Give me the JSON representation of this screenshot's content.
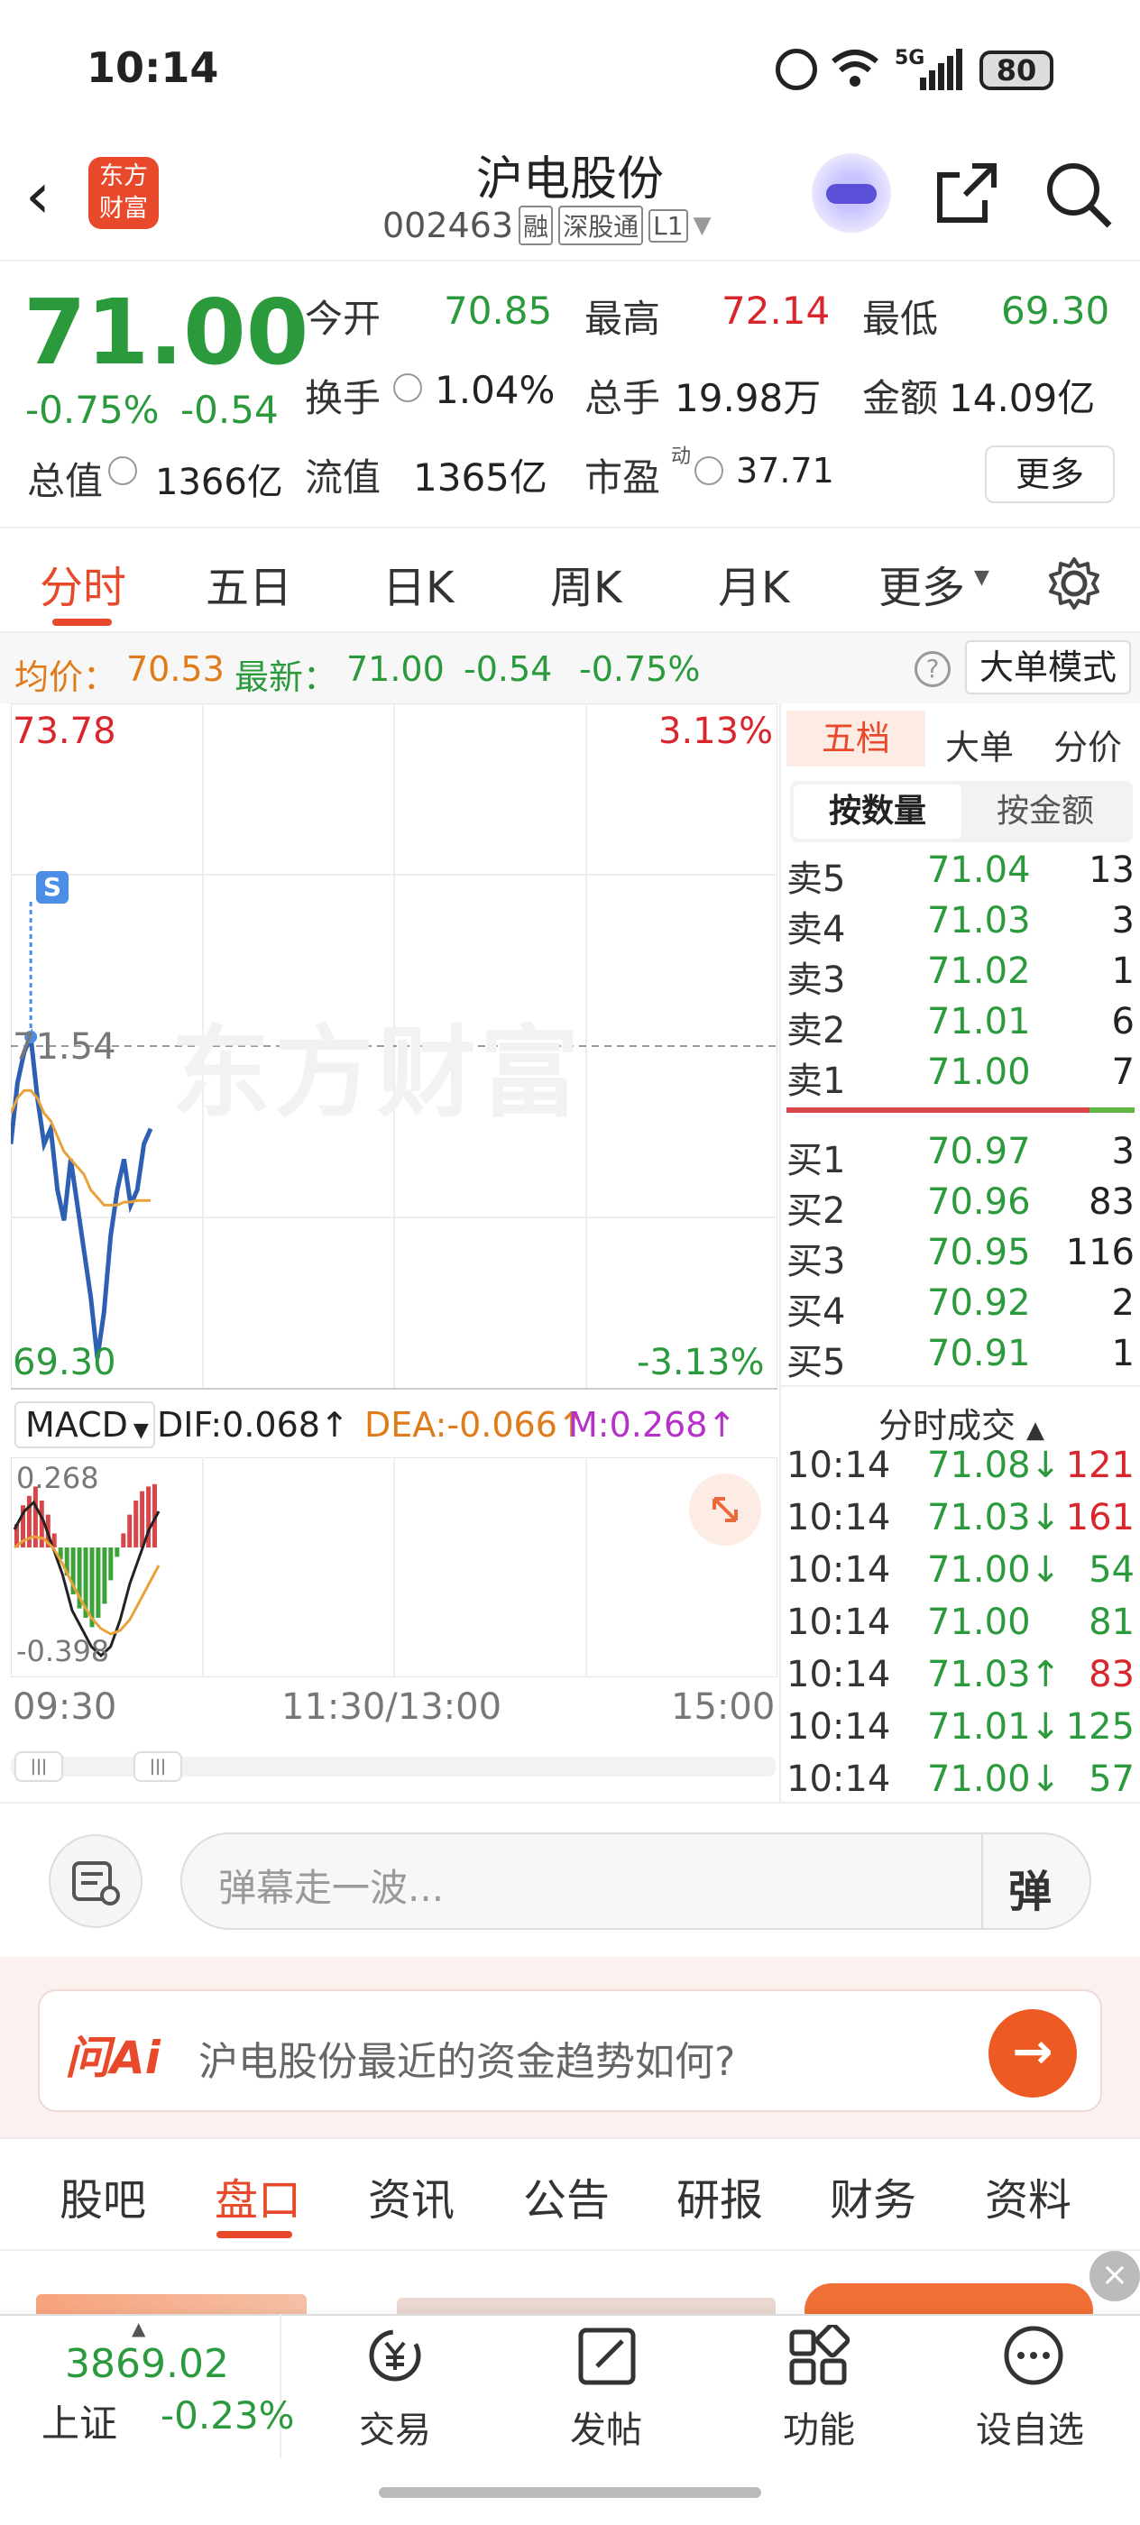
{
  "status": {
    "time": "10:14",
    "battery": "80",
    "network": "5G"
  },
  "header": {
    "logo_line1": "东方",
    "logo_line2": "财富",
    "title": "沪电股份",
    "code": "002463",
    "tags": [
      "融",
      "深股通",
      "L1"
    ]
  },
  "quote": {
    "price": "71.00",
    "pct": "-0.75%",
    "chg": "-0.54",
    "open_label": "今开",
    "open": "70.85",
    "high_label": "最高",
    "high": "72.14",
    "low_label": "最低",
    "low": "69.30",
    "turnover_label": "换手",
    "turnover": "1.04%",
    "volume_label": "总手",
    "volume": "19.98万",
    "amount_label": "金额",
    "amount": "14.09亿",
    "mcap_label": "总值",
    "mcap": "1366亿",
    "float_label": "流值",
    "float": "1365亿",
    "pe_label": "市盈",
    "pe_sup": "动",
    "pe": "37.71",
    "more": "更多"
  },
  "tabs": [
    "分时",
    "五日",
    "日K",
    "周K",
    "月K",
    "更多"
  ],
  "info_line": {
    "avg_label": "均价：",
    "avg": "70.53",
    "latest_label": "最新：",
    "latest": "71.00",
    "chg": "-0.54",
    "pct": "-0.75%",
    "mode": "大单模式"
  },
  "chart": {
    "y_top": "73.78",
    "y_mid": "71.54",
    "y_bottom": "69.30",
    "pct_top": "3.13%",
    "pct_bottom": "-3.13%",
    "marker": "S",
    "watermark": "东方财富",
    "macd_label": "MACD",
    "dif": "DIF:0.068",
    "dea": "DEA:-0.066",
    "m": "M:0.268",
    "macd_top": "0.268",
    "macd_bottom": "-0.398",
    "time_start": "09:30",
    "time_mid": "11:30/13:00",
    "time_end": "15:00"
  },
  "chart_data": {
    "type": "line",
    "title": "",
    "series": [
      {
        "name": "",
        "values": [
          70.9,
          71.3,
          71.5,
          71.6,
          71.2,
          70.9,
          71.0,
          70.6,
          70.4,
          70.8,
          70.5,
          70.2,
          69.9,
          69.5,
          69.8,
          70.3,
          70.6,
          70.8,
          70.5,
          70.6,
          70.9,
          71.0
        ]
      },
      {
        "name": "均价",
        "values": [
          71.1,
          71.2,
          71.25,
          71.25,
          71.2,
          71.1,
          71.05,
          70.95,
          70.85,
          70.8,
          70.75,
          70.7,
          70.6,
          70.55,
          70.5,
          70.5,
          70.5,
          70.52,
          70.52,
          70.53,
          70.53,
          70.53
        ]
      }
    ],
    "ylim": [
      69.3,
      73.78
    ]
  },
  "orderbook": {
    "tabs": [
      "五档",
      "大单",
      "分价"
    ],
    "subtabs": [
      "按数量",
      "按金额"
    ],
    "asks": [
      {
        "l": "卖5",
        "p": "71.04",
        "v": "13"
      },
      {
        "l": "卖4",
        "p": "71.03",
        "v": "3"
      },
      {
        "l": "卖3",
        "p": "71.02",
        "v": "1"
      },
      {
        "l": "卖2",
        "p": "71.01",
        "v": "6"
      },
      {
        "l": "卖1",
        "p": "71.00",
        "v": "7"
      }
    ],
    "bids": [
      {
        "l": "买1",
        "p": "70.97",
        "v": "3"
      },
      {
        "l": "买2",
        "p": "70.96",
        "v": "83"
      },
      {
        "l": "买3",
        "p": "70.95",
        "v": "116"
      },
      {
        "l": "买4",
        "p": "70.92",
        "v": "2"
      },
      {
        "l": "买5",
        "p": "70.91",
        "v": "1"
      }
    ]
  },
  "ticks": {
    "title": "分时成交",
    "rows": [
      {
        "t": "10:14",
        "p": "71.08↓",
        "v": "121"
      },
      {
        "t": "10:14",
        "p": "71.03↓",
        "v": "161"
      },
      {
        "t": "10:14",
        "p": "71.00↓",
        "v": "54"
      },
      {
        "t": "10:14",
        "p": "71.00",
        "v": "81"
      },
      {
        "t": "10:14",
        "p": "71.03↑",
        "v": "83"
      },
      {
        "t": "10:14",
        "p": "71.01↓",
        "v": "125"
      },
      {
        "t": "10:14",
        "p": "71.00↓",
        "v": "57"
      }
    ]
  },
  "danmu": {
    "placeholder": "弹幕走一波...",
    "btn": "弹"
  },
  "ai": {
    "logo": "问Ai",
    "question": "沪电股份最近的资金趋势如何?"
  },
  "nav": [
    "股吧",
    "盘口",
    "资讯",
    "公告",
    "研报",
    "财务",
    "资料"
  ],
  "bottom": {
    "index_value": "3869.02",
    "index_name": "上证",
    "index_pct": "-0.23%",
    "items": [
      "交易",
      "发帖",
      "功能",
      "设自选"
    ]
  }
}
